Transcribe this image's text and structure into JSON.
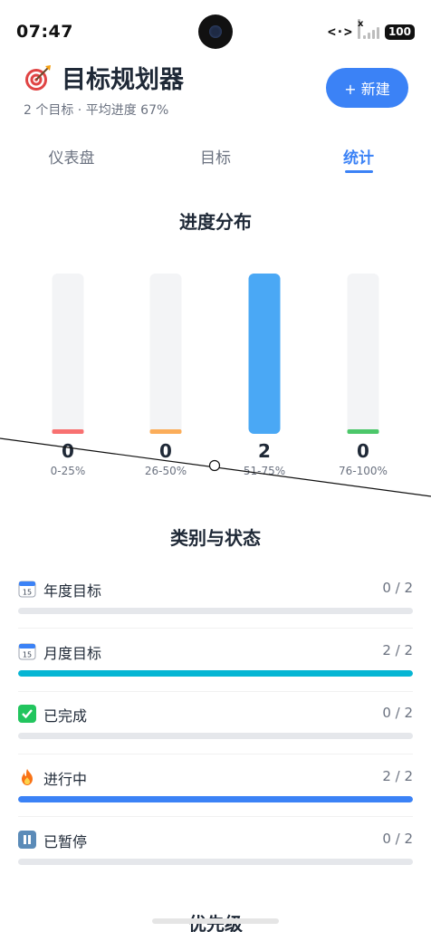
{
  "status_bar": {
    "time": "07:47",
    "network": "<·>",
    "signal_mark": "x",
    "battery": "100"
  },
  "header": {
    "icon": "target-icon",
    "title": "目标规划器",
    "subtitle": "2 个目标 · 平均进度 67%",
    "new_button_label": "+ 新建"
  },
  "tabs": [
    {
      "label": "仪表盘",
      "active": false
    },
    {
      "label": "目标",
      "active": false
    },
    {
      "label": "统计",
      "active": true
    }
  ],
  "colors": {
    "accent": "#3b82f6",
    "track": "#f3f4f6",
    "bar_0_25": "#f87171",
    "bar_26_50": "#fbad5a",
    "bar_51_75": "#4aa8f5",
    "bar_76_100": "#4cc76a",
    "monthly_fill": "#06b6d4",
    "in_progress_fill": "#3b82f6"
  },
  "progress_section": {
    "title": "进度分布"
  },
  "chart_data": {
    "type": "bar",
    "title": "进度分布",
    "categories": [
      "0-25%",
      "26-50%",
      "51-75%",
      "76-100%"
    ],
    "values": [
      0,
      0,
      2,
      0
    ],
    "ylim": [
      0,
      2
    ],
    "grid": false,
    "legend": "none"
  },
  "category_section": {
    "title": "类别与状态",
    "items": [
      {
        "icon": "calendar-icon",
        "label": "年度目标",
        "count": "0 / 2",
        "progress": 0
      },
      {
        "icon": "calendar-icon",
        "label": "月度目标",
        "count": "2 / 2",
        "progress": 1
      },
      {
        "icon": "check-icon",
        "label": "已完成",
        "count": "0 / 2",
        "progress": 0
      },
      {
        "icon": "fire-icon",
        "label": "进行中",
        "count": "2 / 2",
        "progress": 1
      },
      {
        "icon": "pause-icon",
        "label": "已暂停",
        "count": "0 / 2",
        "progress": 0
      }
    ]
  },
  "priority_section": {
    "title": "优先级"
  }
}
